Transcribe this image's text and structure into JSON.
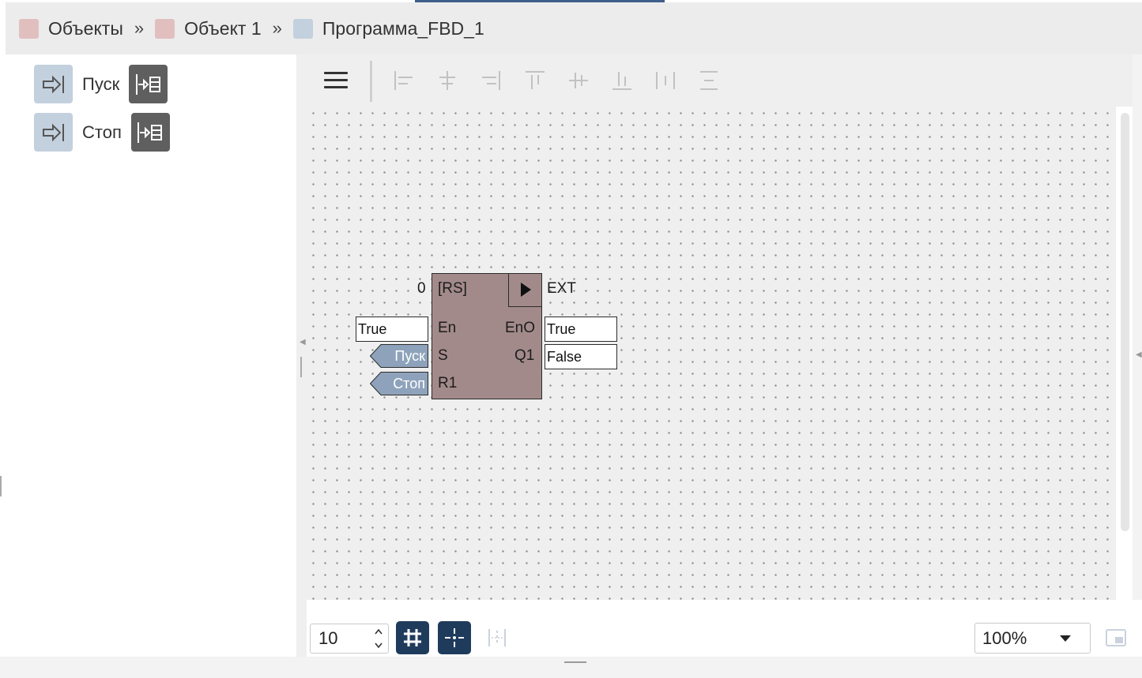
{
  "breadcrumb": [
    {
      "label": "Объекты",
      "color": "#e2bfbf"
    },
    {
      "label": "Объект 1",
      "color": "#e2bfbf"
    },
    {
      "label": "Программа_FBD_1",
      "color": "#c3d0de"
    }
  ],
  "breadcrumb_separator": "»",
  "variables": [
    {
      "label": "Пуск",
      "icon": "input-arrow-icon",
      "action_icon": "insert-block-icon"
    },
    {
      "label": "Стоп",
      "icon": "input-arrow-icon",
      "action_icon": "insert-block-icon"
    }
  ],
  "toolbar": {
    "menu_icon": "hamburger-icon",
    "align_icons": [
      "align-left-icon",
      "align-center-horizontal-icon",
      "align-right-icon",
      "align-top-icon",
      "align-center-vertical-icon",
      "align-bottom-icon",
      "distribute-horizontal-icon",
      "distribute-vertical-icon"
    ]
  },
  "block": {
    "index": "0",
    "type": "[RS]",
    "ext_label": "EXT",
    "inputs": [
      "En",
      "S",
      "R1"
    ],
    "outputs": [
      "EnO",
      "Q1"
    ],
    "fill_color": "#a38a8a",
    "en_value": "True",
    "s_tag": "Пуск",
    "r1_tag": "Стоп",
    "eno_value": "True",
    "q1_value": "False"
  },
  "bottom": {
    "grid_step": "10",
    "zoom": "100%",
    "accent_color": "#1f3b5c"
  }
}
